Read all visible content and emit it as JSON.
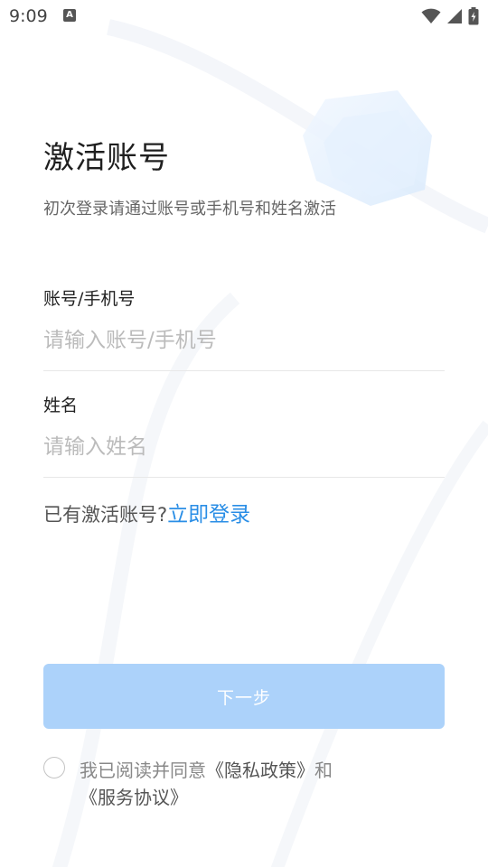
{
  "status_bar": {
    "time": "9:09",
    "notification_icon": "A"
  },
  "header": {
    "title": "激活账号",
    "subtitle": "初次登录请通过账号或手机号和姓名激活"
  },
  "form": {
    "account": {
      "label": "账号/手机号",
      "placeholder": "请输入账号/手机号"
    },
    "name": {
      "label": "姓名",
      "placeholder": "请输入姓名"
    }
  },
  "login": {
    "prompt": "已有激活账号?",
    "link": "立即登录"
  },
  "next_button": {
    "label": "下一步"
  },
  "agreement": {
    "prefix": "我已阅读并同意",
    "privacy_link": "《隐私政策》",
    "conjunction": "和",
    "service_link": "《服务协议》"
  },
  "colors": {
    "accent": "#2a8ee6",
    "button_disabled": "#acd2fa",
    "placeholder": "#bbbbbb",
    "divider": "#e8e8e8"
  },
  "icons": {
    "status": [
      "wifi-icon",
      "signal-icon",
      "battery-charging-icon"
    ],
    "checkbox": "radio-unchecked-icon"
  }
}
